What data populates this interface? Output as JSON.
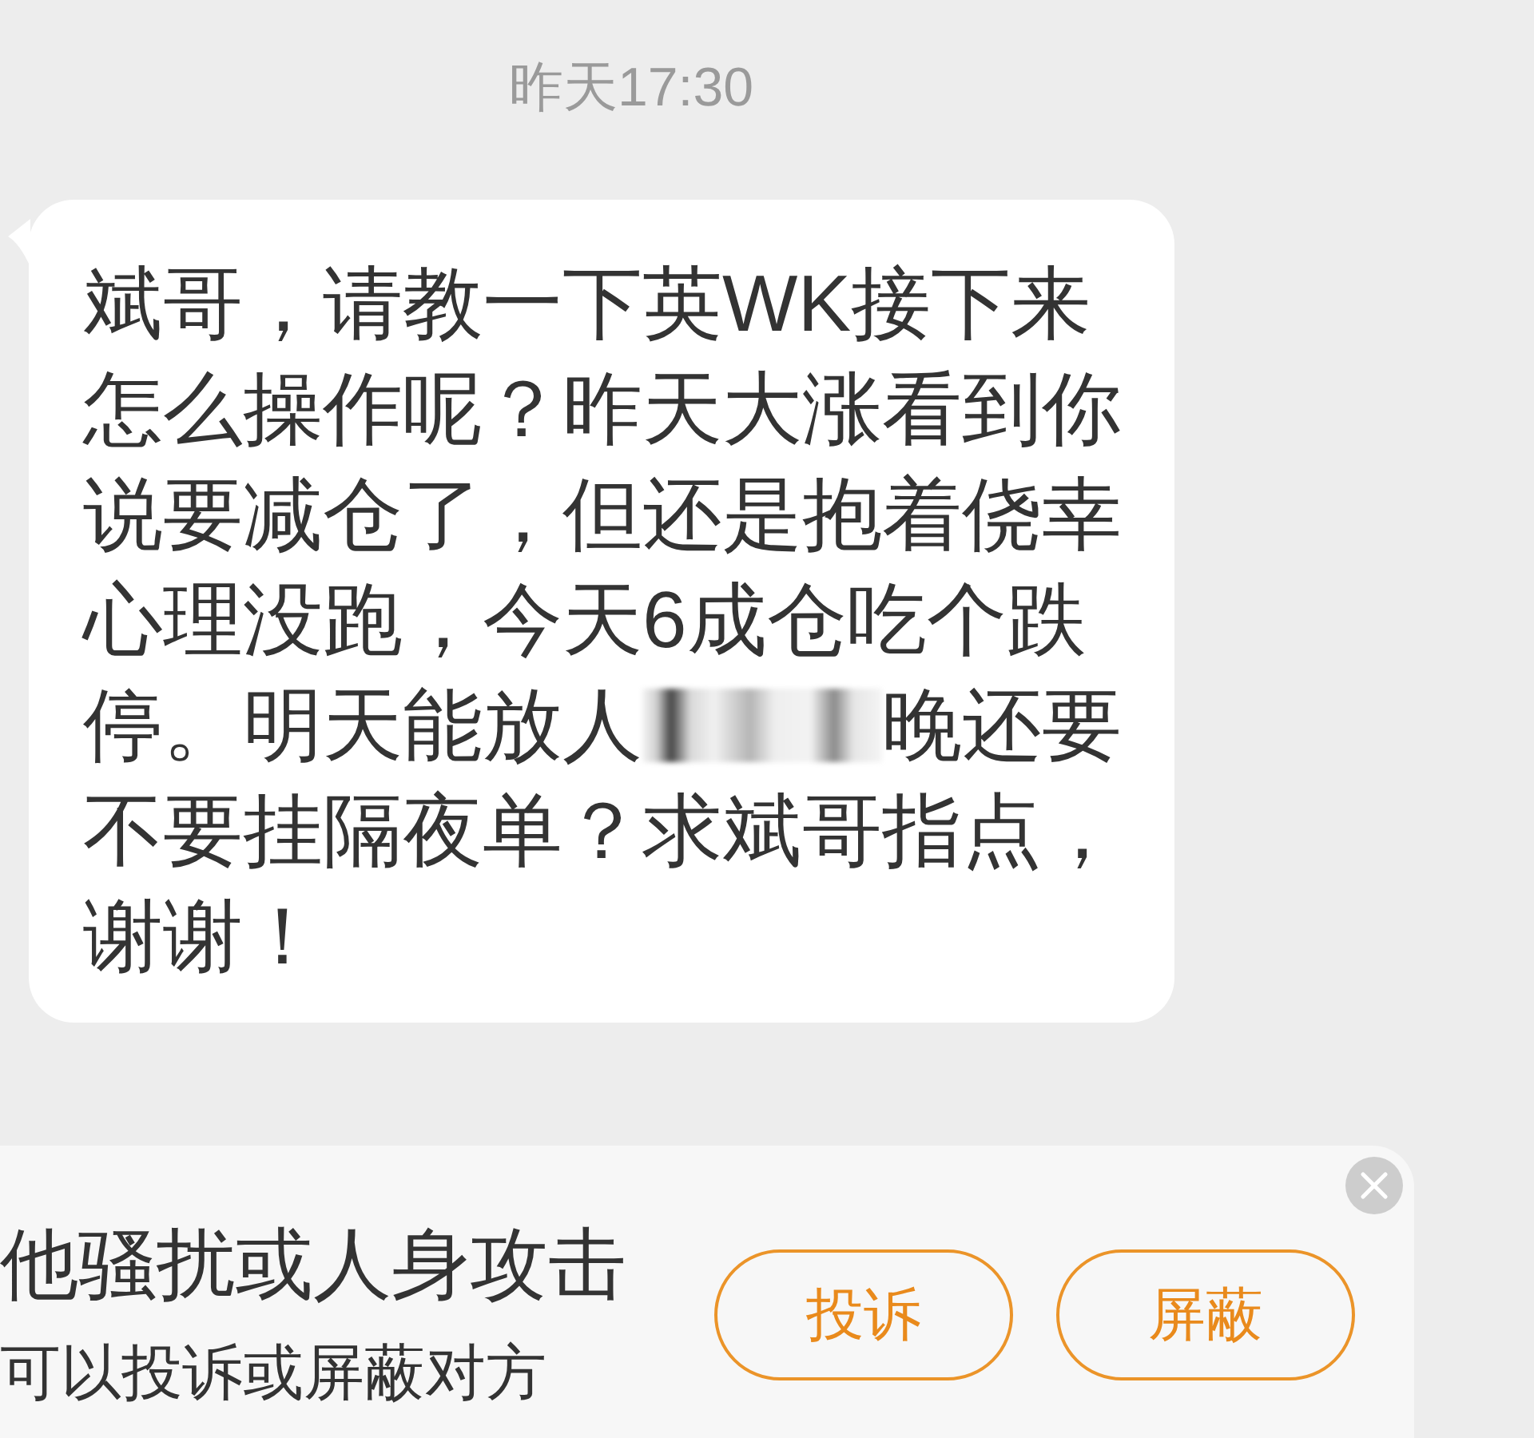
{
  "timestamp": "昨天17:30",
  "message": {
    "blocks": [
      {
        "kind": "text",
        "text": "斌哥，请教一下英WK接下来怎么操作呢？昨天大涨看到你说要减仓了，但还是抱着侥幸心理没跑，今天6成仓吃个跌"
      },
      {
        "kind": "redacted_line",
        "before": "停。明天能放人",
        "after": "晚还要"
      },
      {
        "kind": "text",
        "text": "不要挂隔夜单？求斌哥指点，谢谢！"
      }
    ]
  },
  "notice": {
    "title": "他骚扰或人身攻击",
    "subtitle": "可以投诉或屏蔽对方",
    "buttons": [
      "投诉",
      "屏蔽"
    ]
  }
}
